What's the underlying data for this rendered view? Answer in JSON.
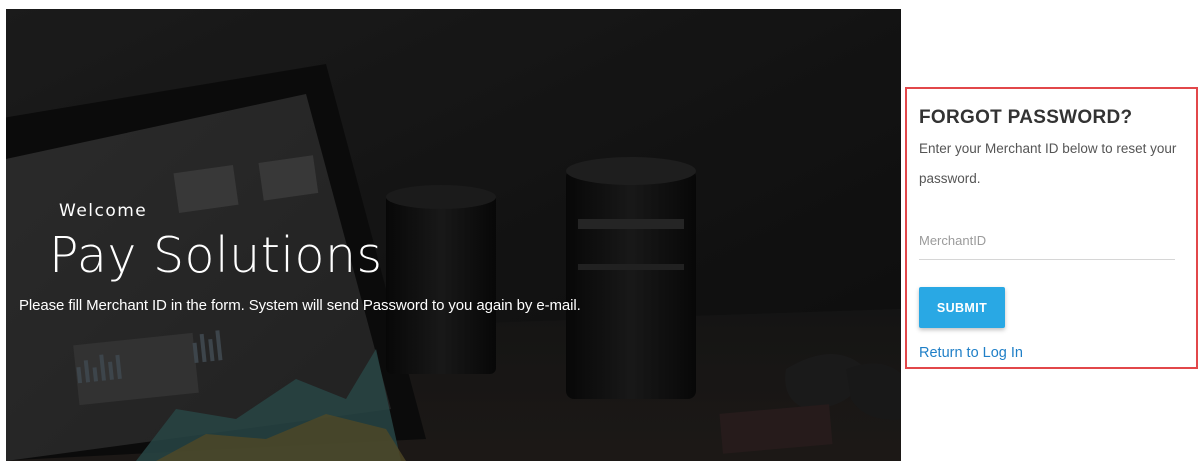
{
  "hero": {
    "welcome": "Welcome",
    "brand": "Pay Solutions",
    "description": "Please fill Merchant ID in the form. System will send Password to you again by e-mail.",
    "background": "laptop-dashboard-camera-lens-photo"
  },
  "forgot": {
    "title": "FORGOT PASSWORD?",
    "subtitle": "Enter your Merchant ID below to reset your password.",
    "merchant_placeholder": "MerchantID",
    "merchant_value": "",
    "submit_label": "SUBMIT",
    "return_link": "Return to Log In"
  },
  "colors": {
    "panel_border": "#e2474a",
    "submit_bg": "#29a8e4",
    "link": "#1f7fc7",
    "hero_overlay": "#1d1d1d"
  }
}
